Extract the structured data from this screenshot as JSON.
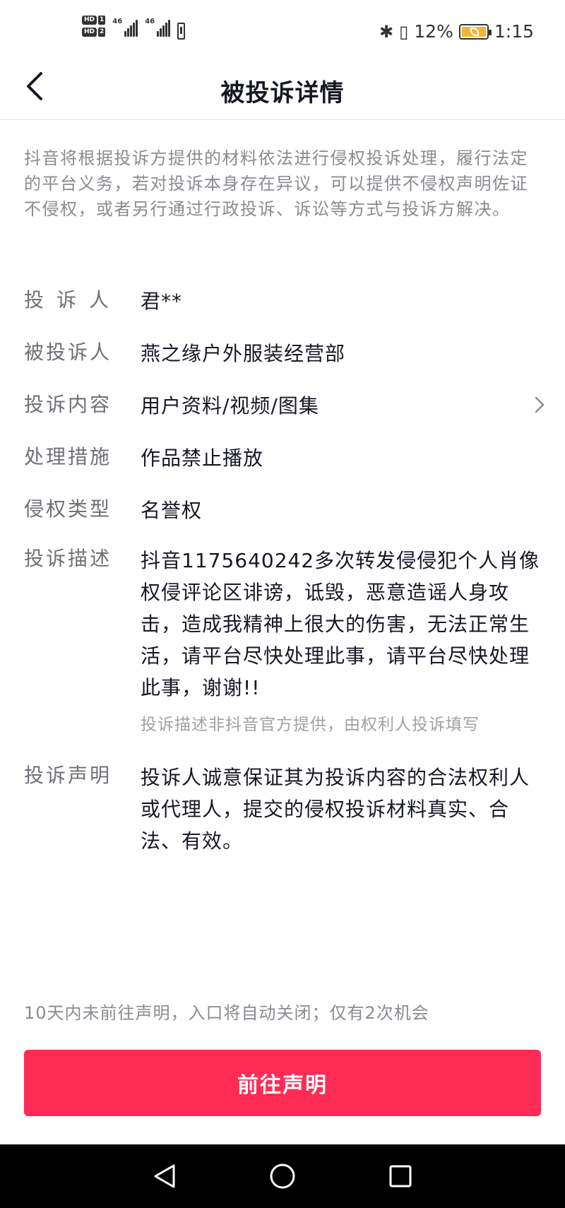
{
  "status_bar": {
    "hd1": "HD",
    "hd1_num": "1",
    "hd2": "HD",
    "hd2_num": "2",
    "signal1_label": "46",
    "signal2_label": "46",
    "battery_percent": "12%",
    "battery_color": "#f2b533",
    "time": "1:15",
    "icons": [
      "sim-alert-icon",
      "bluetooth-icon",
      "vibrate-icon",
      "battery-icon"
    ]
  },
  "header": {
    "title": "被投诉详情",
    "back_icon": "chevron-left-icon"
  },
  "notice": "抖音将根据投诉方提供的材料依法进行侵权投诉处理，履行法定的平台义务，若对投诉本身存在异议，可以提供不侵权声明佐证不侵权，或者另行通过行政投诉、诉讼等方式与投诉方解决。",
  "details": {
    "complainant": {
      "label": "投诉人",
      "value": "君**"
    },
    "respondent": {
      "label": "被投诉人",
      "value": "燕之缘户外服装经营部"
    },
    "content": {
      "label": "投诉内容",
      "value": "用户资料/视频/图集",
      "icon": "chevron-right-icon"
    },
    "measure": {
      "label": "处理措施",
      "value": "作品禁止播放"
    },
    "type": {
      "label": "侵权类型",
      "value": "名誉权"
    },
    "description": {
      "label": "投诉描述",
      "value": "抖音1175640242多次转发侵侵犯个人肖像权侵评论区诽谤，诋毁，恶意造谣人身攻击，造成我精神上很大的伤害，无法正常生活，请平台尽快处理此事，请平台尽快处理此事，谢谢!!",
      "note": "投诉描述非抖音官方提供，由权利人投诉填写"
    },
    "statement": {
      "label": "投诉声明",
      "value": "投诉人诚意保证其为投诉内容的合法权利人或代理人，提交的侵权投诉材料真实、合法、有效。"
    }
  },
  "footer": {
    "deadline": "10天内未前往声明，入口将自动关闭；仅有2次机会",
    "button_label": "前往声明",
    "button_color": "#fe2c55"
  },
  "nav": {
    "icons": [
      "back-triangle-icon",
      "home-circle-icon",
      "recents-square-icon"
    ]
  }
}
